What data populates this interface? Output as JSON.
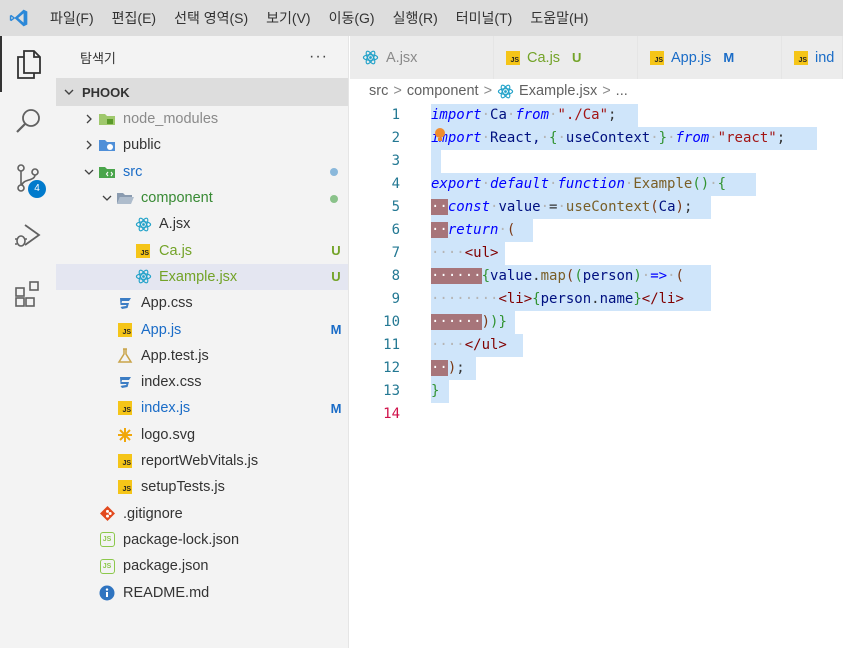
{
  "menubar": {
    "items": [
      "파일(F)",
      "편집(E)",
      "선택 영역(S)",
      "보기(V)",
      "이동(G)",
      "실행(R)",
      "터미널(T)",
      "도움말(H)"
    ]
  },
  "activity_bar": {
    "items": [
      "explorer",
      "search",
      "source-control",
      "run-and-debug",
      "extensions"
    ],
    "scm_badge": "4"
  },
  "explorer": {
    "title": "탐색기",
    "more": "···",
    "project": "PHOOK",
    "tree": [
      {
        "name": "node_modules",
        "icon": "folder-node-icon",
        "indent": 0,
        "type": "folder",
        "expanded": false,
        "color": "#8a8a8a",
        "status": ""
      },
      {
        "name": "public",
        "icon": "folder-public-icon",
        "indent": 0,
        "type": "folder",
        "expanded": false,
        "color": "#333333",
        "status": ""
      },
      {
        "name": "src",
        "icon": "folder-src-icon",
        "indent": 0,
        "type": "folder",
        "expanded": true,
        "color": "#1a6cc7",
        "status": "dot-blue"
      },
      {
        "name": "component",
        "icon": "folder-open-icon",
        "indent": 1,
        "type": "folder",
        "expanded": true,
        "color": "#388a34",
        "status": "dot-green"
      },
      {
        "name": "A.jsx",
        "icon": "react-icon",
        "indent": 2,
        "type": "file",
        "color": "#333333",
        "status": ""
      },
      {
        "name": "Ca.js",
        "icon": "js-icon",
        "indent": 2,
        "type": "file",
        "color": "#73a328",
        "status": "U"
      },
      {
        "name": "Example.jsx",
        "icon": "react-icon",
        "indent": 2,
        "type": "file",
        "color": "#73a328",
        "status": "U",
        "selected": true
      },
      {
        "name": "App.css",
        "icon": "css-icon",
        "indent": 1,
        "type": "file",
        "color": "#333333",
        "status": ""
      },
      {
        "name": "App.js",
        "icon": "js-icon",
        "indent": 1,
        "type": "file",
        "color": "#1a6cc7",
        "status": "M"
      },
      {
        "name": "App.test.js",
        "icon": "flask-icon",
        "indent": 1,
        "type": "file",
        "color": "#333333",
        "status": ""
      },
      {
        "name": "index.css",
        "icon": "css-icon",
        "indent": 1,
        "type": "file",
        "color": "#333333",
        "status": ""
      },
      {
        "name": "index.js",
        "icon": "js-icon",
        "indent": 1,
        "type": "file",
        "color": "#1a6cc7",
        "status": "M"
      },
      {
        "name": "logo.svg",
        "icon": "svg-icon",
        "indent": 1,
        "type": "file",
        "color": "#333333",
        "status": ""
      },
      {
        "name": "reportWebVitals.js",
        "icon": "js-icon",
        "indent": 1,
        "type": "file",
        "color": "#333333",
        "status": ""
      },
      {
        "name": "setupTests.js",
        "icon": "js-icon",
        "indent": 1,
        "type": "file",
        "color": "#333333",
        "status": ""
      },
      {
        "name": ".gitignore",
        "icon": "git-icon",
        "indent": 0,
        "type": "file",
        "color": "#333333",
        "status": ""
      },
      {
        "name": "package-lock.json",
        "icon": "json-icon",
        "indent": 0,
        "type": "file",
        "color": "#333333",
        "status": ""
      },
      {
        "name": "package.json",
        "icon": "json-icon",
        "indent": 0,
        "type": "file",
        "color": "#333333",
        "status": ""
      },
      {
        "name": "README.md",
        "icon": "info-icon",
        "indent": 0,
        "type": "file",
        "color": "#333333",
        "status": ""
      }
    ],
    "status_colors": {
      "U": "#73a328",
      "M": "#1a6cc7",
      "dot-blue": "#8ab8db",
      "dot-green": "#8ac28a"
    }
  },
  "tabs": [
    {
      "label": "A.jsx",
      "icon": "react-icon",
      "status": "",
      "color": "#8a8a8a"
    },
    {
      "label": "Ca.js",
      "icon": "js-icon",
      "status": "U",
      "color": "#73a328"
    },
    {
      "label": "App.js",
      "icon": "js-icon",
      "status": "M",
      "color": "#1a6cc7"
    },
    {
      "label": "ind",
      "icon": "js-icon",
      "status": "",
      "color": "#1a6cc7"
    }
  ],
  "breadcrumb": {
    "parts": [
      "src",
      "component",
      "Example.jsx",
      "..."
    ],
    "sep": ">"
  },
  "editor": {
    "line_numbers": [
      "1",
      "2",
      "3",
      "4",
      "5",
      "6",
      "7",
      "8",
      "9",
      "10",
      "11",
      "12",
      "13",
      "14"
    ],
    "active_line": "14",
    "lines": [
      [
        [
          "kw",
          "import"
        ],
        [
          "ws",
          "·"
        ],
        [
          "pl",
          "Ca"
        ],
        [
          "ws",
          "·"
        ],
        [
          "kw",
          "from"
        ],
        [
          "ws",
          "·"
        ],
        [
          "str",
          "\"./Ca\""
        ],
        [
          "pu",
          ";"
        ]
      ],
      [
        [
          "kw",
          "import"
        ],
        [
          "ws",
          "·"
        ],
        [
          "pl",
          "React,"
        ],
        [
          "ws",
          "·"
        ],
        [
          "par",
          "{"
        ],
        [
          "ws",
          "·"
        ],
        [
          "pl",
          "useContext"
        ],
        [
          "ws",
          "·"
        ],
        [
          "par",
          "}"
        ],
        [
          "ws",
          "·"
        ],
        [
          "kw",
          "from"
        ],
        [
          "ws",
          "·"
        ],
        [
          "str",
          "\"react\""
        ],
        [
          "pu",
          ";"
        ]
      ],
      [
        [
          "ws",
          " "
        ]
      ],
      [
        [
          "kw",
          "export"
        ],
        [
          "ws",
          "·"
        ],
        [
          "kw",
          "default"
        ],
        [
          "ws",
          "·"
        ],
        [
          "kw",
          "function"
        ],
        [
          "ws",
          "·"
        ],
        [
          "fn",
          "Example"
        ],
        [
          "par",
          "()"
        ],
        [
          "ws",
          "·"
        ],
        [
          "par",
          "{"
        ]
      ],
      [
        [
          "ind",
          "··"
        ],
        [
          "kw",
          "const"
        ],
        [
          "ws",
          "·"
        ],
        [
          "pl",
          "value"
        ],
        [
          "ws",
          "·"
        ],
        [
          "pu",
          "="
        ],
        [
          "ws",
          "·"
        ],
        [
          "fn",
          "useContext"
        ],
        [
          "brc",
          "("
        ],
        [
          "pl",
          "Ca"
        ],
        [
          "brc",
          ")"
        ],
        [
          "pu",
          ";"
        ]
      ],
      [
        [
          "ind",
          "··"
        ],
        [
          "kw",
          "return"
        ],
        [
          "ws",
          "·"
        ],
        [
          "brc",
          "("
        ]
      ],
      [
        [
          "ws",
          "····"
        ],
        [
          "tag",
          "<ul>"
        ]
      ],
      [
        [
          "ind",
          "······"
        ],
        [
          "par",
          "{"
        ],
        [
          "pl",
          "value"
        ],
        [
          "pu",
          "."
        ],
        [
          "fn",
          "map"
        ],
        [
          "brc",
          "("
        ],
        [
          "par",
          "("
        ],
        [
          "pl",
          "person"
        ],
        [
          "par",
          ")"
        ],
        [
          "ws",
          "·"
        ],
        [
          "kw",
          "=>"
        ],
        [
          "ws",
          "·"
        ],
        [
          "brc",
          "("
        ]
      ],
      [
        [
          "ws",
          "········"
        ],
        [
          "tag",
          "<li>"
        ],
        [
          "par",
          "{"
        ],
        [
          "pl",
          "person"
        ],
        [
          "pu",
          "."
        ],
        [
          "pl",
          "name"
        ],
        [
          "par",
          "}"
        ],
        [
          "tag",
          "</li>"
        ]
      ],
      [
        [
          "ind",
          "······"
        ],
        [
          "brc",
          ")"
        ],
        [
          "par",
          ")"
        ],
        [
          "par",
          "}"
        ]
      ],
      [
        [
          "ws",
          "····"
        ],
        [
          "tag",
          "</ul>"
        ]
      ],
      [
        [
          "ind",
          "··"
        ],
        [
          "brc",
          ")"
        ],
        [
          "pu",
          ";"
        ]
      ],
      [
        [
          "par",
          "}"
        ]
      ],
      [
        [
          "ws",
          ""
        ]
      ]
    ],
    "selection_widths": [
      207,
      386,
      10,
      325,
      280,
      102,
      74,
      280,
      280,
      84,
      92,
      45,
      18,
      0
    ]
  }
}
